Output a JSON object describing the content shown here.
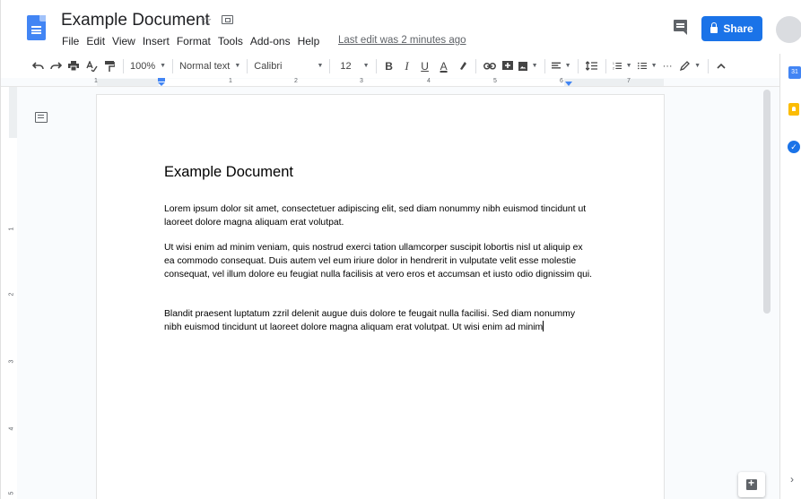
{
  "document": {
    "title": "Example Document",
    "last_edit": "Last edit was 2 minutes ago"
  },
  "menu": [
    "File",
    "Edit",
    "View",
    "Insert",
    "Format",
    "Tools",
    "Add-ons",
    "Help"
  ],
  "header": {
    "share_label": "Share"
  },
  "toolbar": {
    "zoom": "100%",
    "style": "Normal text",
    "font": "Calibri",
    "size": "12",
    "bold": "B",
    "italic": "I",
    "underline": "U",
    "text_color": "A",
    "more": "···"
  },
  "ruler": {
    "h_numbers": [
      "1",
      "1",
      "2",
      "3",
      "4",
      "5",
      "6",
      "7"
    ],
    "v_numbers": [
      "1",
      "2",
      "3",
      "4",
      "5"
    ]
  },
  "page": {
    "heading": "Example Document",
    "paragraphs": [
      "Lorem ipsum dolor sit amet, consectetuer adipiscing elit, sed diam nonummy nibh euismod tincidunt ut laoreet dolore magna aliquam erat volutpat.",
      "Ut wisi enim ad minim veniam, quis nostrud exerci tation ullamcorper suscipit lobortis nisl ut aliquip ex ea commodo consequat. Duis autem vel eum iriure dolor in hendrerit in vulputate velit esse molestie consequat, vel illum dolore eu feugiat nulla facilisis at vero eros et accumsan et iusto odio dignissim qui.",
      "Blandit praesent luptatum zzril delenit augue duis dolore te feugait nulla facilisi. Sed diam nonummy nibh euismod tincidunt ut laoreet dolore magna aliquam erat volutpat. Ut wisi enim ad minim"
    ]
  },
  "sidepanel": {
    "calendar_label": "31"
  },
  "colors": {
    "accent": "#1a73e8",
    "docs_blue": "#4285f4",
    "keep_yellow": "#fbbc04"
  },
  "icons": [
    "docs-logo-icon",
    "star-icon",
    "folder-icon",
    "comment-icon",
    "lock-icon",
    "undo-icon",
    "redo-icon",
    "print-icon",
    "spellcheck-icon",
    "paint-format-icon",
    "highlight-icon",
    "link-icon",
    "insert-comment-icon",
    "image-icon",
    "align-icon",
    "line-spacing-icon",
    "numbered-list-icon",
    "bulleted-list-icon",
    "editing-mode-icon",
    "collapse-icon",
    "outline-icon",
    "calendar-icon",
    "keep-icon",
    "tasks-icon",
    "explore-icon",
    "expand-panel-icon"
  ]
}
